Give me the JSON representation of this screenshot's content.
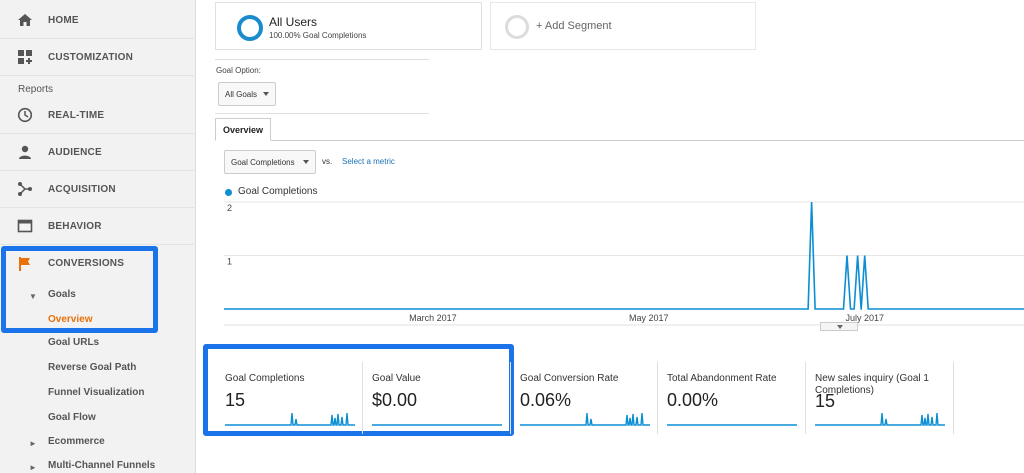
{
  "sidebar": {
    "home": "HOME",
    "customization": "CUSTOMIZATION",
    "reports_label": "Reports",
    "realtime": "REAL-TIME",
    "audience": "AUDIENCE",
    "acquisition": "ACQUISITION",
    "behavior": "BEHAVIOR",
    "conversions": "CONVERSIONS",
    "goals": "Goals",
    "overview": "Overview",
    "goal_urls": "Goal URLs",
    "reverse_goal_path": "Reverse Goal Path",
    "funnel_visualization": "Funnel Visualization",
    "goal_flow": "Goal Flow",
    "ecommerce": "Ecommerce",
    "multi_channel_funnels": "Multi-Channel Funnels",
    "highlight_color": "#1a73e8",
    "active_color": "#e8710a"
  },
  "segments": {
    "all_users_name": "All Users",
    "all_users_sub": "100.00% Goal Completions",
    "add_segment": "+ Add Segment"
  },
  "goal_option": {
    "label": "Goal Option:",
    "selected": "All Goals"
  },
  "tabs": {
    "overview": "Overview"
  },
  "metric_picker": {
    "selected": "Goal Completions",
    "vs": "vs.",
    "select_metric": "Select a metric"
  },
  "chart_data": {
    "type": "line",
    "series": [
      {
        "name": "Goal Completions",
        "color": "#0b8ed3",
        "spikes": [
          {
            "date": "2017-06-16",
            "value": 2
          },
          {
            "date": "2017-06-26",
            "value": 1
          },
          {
            "date": "2017-06-29",
            "value": 1
          },
          {
            "date": "2017-07-01",
            "value": 1
          }
        ]
      }
    ],
    "x_tick_labels": [
      "March 2017",
      "May 2017",
      "July 2017"
    ],
    "y_tick_labels": [
      "2",
      "1"
    ],
    "ylim": [
      0,
      2
    ],
    "grid": true
  },
  "metrics": [
    {
      "label": "Goal Completions",
      "value": "15"
    },
    {
      "label": "Goal Value",
      "value": "$0.00"
    },
    {
      "label": "Goal Conversion Rate",
      "value": "0.06%"
    },
    {
      "label": "Total Abandonment Rate",
      "value": "0.00%"
    },
    {
      "label": "New sales inquiry (Goal 1 Completions)",
      "value": "15"
    }
  ]
}
